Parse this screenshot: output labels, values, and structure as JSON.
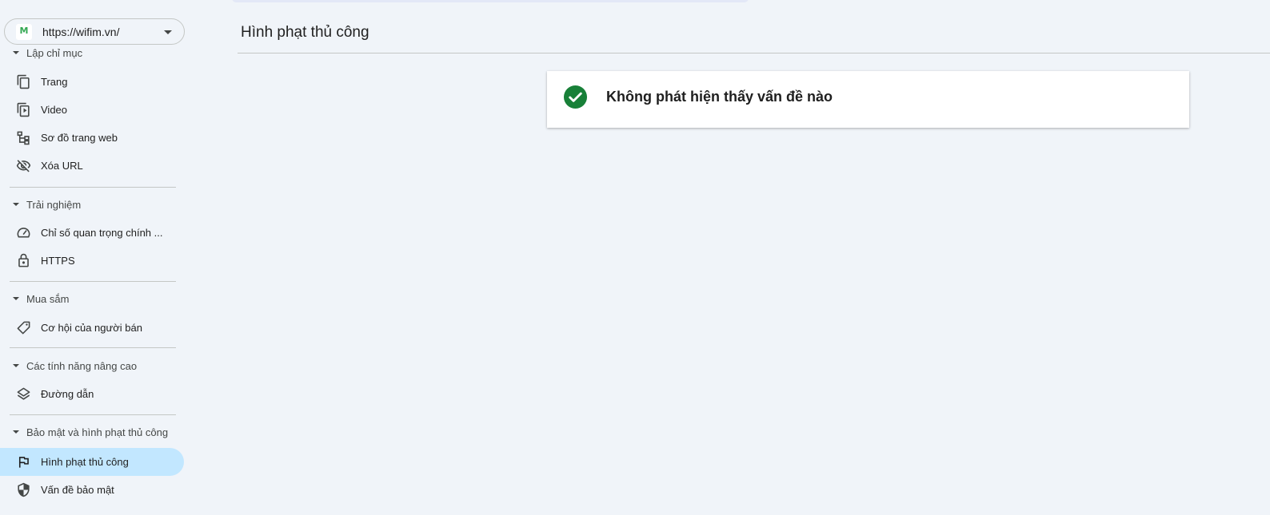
{
  "property": {
    "url": "https://wifim.vn/",
    "logo_letter": "M",
    "logo_icon": "site-favicon",
    "dropdown_icon": "caret-down-icon"
  },
  "sidebar": {
    "sections": [
      {
        "title": "Lập chỉ mục",
        "items": [
          {
            "label": "Trang",
            "icon": "pages-icon"
          },
          {
            "label": "Video",
            "icon": "video-pages-icon"
          },
          {
            "label": "Sơ đồ trang web",
            "icon": "sitemap-icon"
          },
          {
            "label": "Xóa URL",
            "icon": "eye-off-icon"
          }
        ]
      },
      {
        "title": "Trải nghiệm",
        "items": [
          {
            "label": "Chỉ số quan trọng chính ...",
            "icon": "speedometer-icon"
          },
          {
            "label": "HTTPS",
            "icon": "lock-icon"
          }
        ]
      },
      {
        "title": "Mua sắm",
        "items": [
          {
            "label": "Cơ hội của người bán",
            "icon": "tag-icon"
          }
        ]
      },
      {
        "title": "Các tính năng nâng cao",
        "items": [
          {
            "label": "Đường dẫn",
            "icon": "layers-icon"
          }
        ]
      },
      {
        "title": "Bảo mật và hình phạt thủ công",
        "items": [
          {
            "label": "Hình phạt thủ công",
            "icon": "flag-icon",
            "active": true
          },
          {
            "label": "Vấn đề bảo mật",
            "icon": "shield-icon"
          }
        ]
      }
    ]
  },
  "main": {
    "title": "Hình phạt thủ công",
    "status": {
      "message": "Không phát hiện thấy vấn đề nào",
      "icon": "check-circle-icon"
    }
  },
  "colors": {
    "background": "#f0f4f9",
    "active_item": "#c2e7ff",
    "success": "#188038",
    "divider": "#c4c7c5"
  }
}
